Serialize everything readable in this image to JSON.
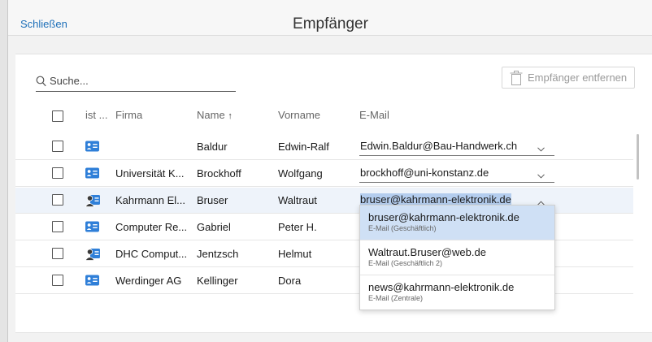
{
  "header": {
    "close_label": "Schließen",
    "title": "Empfänger"
  },
  "toolbar": {
    "search_placeholder": "Suche...",
    "remove_label": "Empfänger entfernen"
  },
  "table": {
    "columns": [
      "ist ...",
      "Firma",
      "Name",
      "Vorname",
      "E-Mail"
    ],
    "sort_indicator": "↑",
    "rows": [
      {
        "type": "card",
        "firma": "",
        "name": "Baldur",
        "vorname": "Edwin-Ralf",
        "email": "Edwin.Baldur@Bau-Handwerk.ch"
      },
      {
        "type": "card",
        "firma": "Universität K...",
        "name": "Brockhoff",
        "vorname": "Wolfgang",
        "email": "brockhoff@uni-konstanz.de"
      },
      {
        "type": "person",
        "firma": "Kahrmann El...",
        "name": "Bruser",
        "vorname": "Waltraut",
        "email": "bruser@kahrmann-elektronik.de"
      },
      {
        "type": "card",
        "firma": "Computer Re...",
        "name": "Gabriel",
        "vorname": "Peter H.",
        "email": ""
      },
      {
        "type": "person",
        "firma": "DHC Comput...",
        "name": "Jentzsch",
        "vorname": "Helmut",
        "email": ""
      },
      {
        "type": "card",
        "firma": "Werdinger AG",
        "name": "Kellinger",
        "vorname": "Dora",
        "email": ""
      }
    ]
  },
  "dropdown": {
    "options": [
      {
        "email": "bruser@kahrmann-elektronik.de",
        "kind": "E-Mail (Geschäftlich)"
      },
      {
        "email": "Waltraut.Bruser@web.de",
        "kind": "E-Mail (Geschäftlich 2)"
      },
      {
        "email": "news@kahrmann-elektronik.de",
        "kind": "E-Mail (Zentrale)"
      }
    ]
  },
  "colors": {
    "accent": "#1d6fb8",
    "icon_blue": "#2f7fd8",
    "row_highlight": "#eef3fa",
    "selected_option": "#cfe0f5"
  }
}
